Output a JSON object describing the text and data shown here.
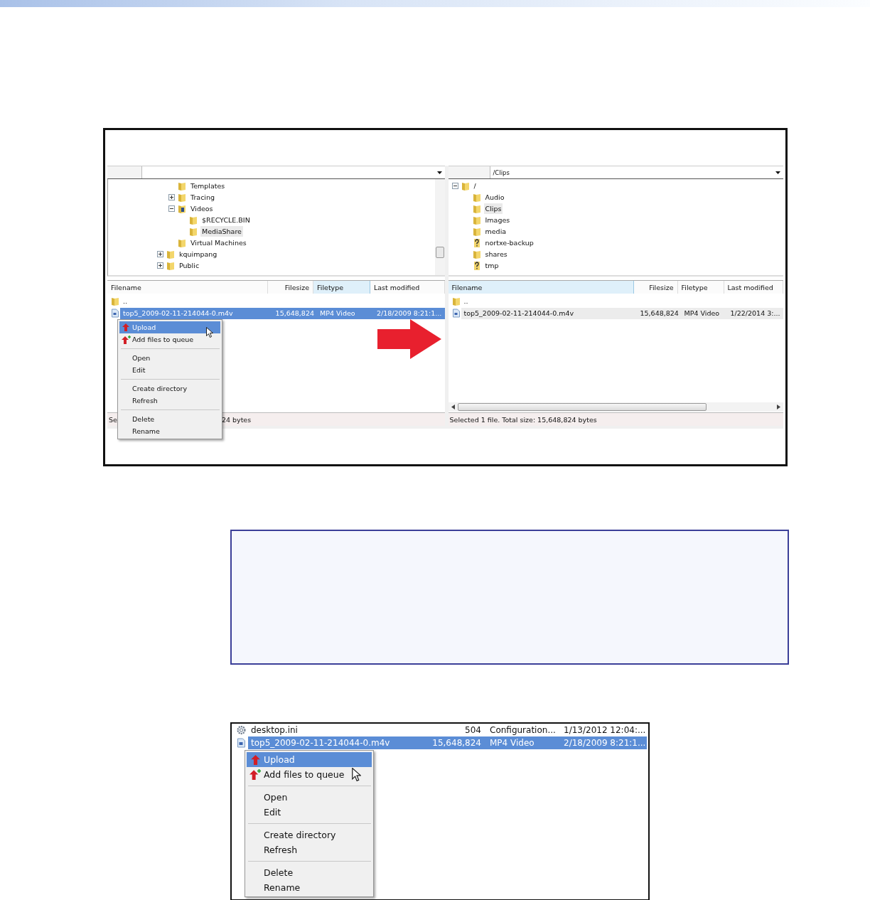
{
  "screenshot_1": {
    "panes": [
      {
        "focused": true,
        "tree": [
          {
            "children": [
              {
                "label": "Templates",
                "kind": "folder",
                "selected": false
              },
              {
                "label": "Tracing",
                "kind": "folder",
                "expanded": false,
                "selected": false
              },
              {
                "label": "Videos",
                "kind": "library",
                "expanded": true,
                "selected": false,
                "children": [
                  {
                    "label": "$RECYCLE.BIN",
                    "kind": "folder",
                    "selected": false
                  },
                  {
                    "label": "MediaShare",
                    "kind": "folder",
                    "selected": true
                  }
                ]
              },
              {
                "label": "Virtual Machines",
                "kind": "folder",
                "selected": false
              }
            ]
          },
          {
            "label": "kquimpang",
            "kind": "folder",
            "expanded": false,
            "selected": false
          },
          {
            "label": "Public",
            "kind": "folder",
            "expanded": false,
            "selected": false
          }
        ],
        "columns": [
          {
            "label": "Filename",
            "sorted": false
          },
          {
            "label": "Filesize",
            "sorted": false
          },
          {
            "label": "Filetype",
            "sorted": true
          },
          {
            "label": "Last modified",
            "sorted": false
          }
        ],
        "rows": [
          {
            "kind": "parent",
            "cells": [
              ".."
            ],
            "selected": false
          },
          {
            "kind": "video",
            "cells": [
              "top5_2009-02-11-214044-0.m4v",
              "15,648,824",
              "MP4 Video",
              "2/18/2009 8:21:1..."
            ],
            "selected": true
          }
        ],
        "status_parts": [
          "Se",
          "24 bytes"
        ]
      },
      {
        "focused": false,
        "path": "/Clips",
        "tree": [
          {
            "label": "/",
            "kind": "folder",
            "expanded": true,
            "selected": false,
            "children": [
              {
                "label": "Audio",
                "kind": "folder",
                "selected": false
              },
              {
                "label": "Clips",
                "kind": "folder",
                "selected": true
              },
              {
                "label": "Images",
                "kind": "folder",
                "selected": false
              },
              {
                "label": "media",
                "kind": "folder",
                "selected": false
              },
              {
                "label": "nortxe-backup",
                "kind": "unknown",
                "selected": false
              },
              {
                "label": "shares",
                "kind": "folder",
                "selected": false
              },
              {
                "label": "tmp",
                "kind": "unknown",
                "selected": false
              }
            ]
          }
        ],
        "columns": [
          {
            "label": "Filename",
            "sorted": true
          },
          {
            "label": "Filesize",
            "sorted": false
          },
          {
            "label": "Filetype",
            "sorted": false
          },
          {
            "label": "Last modified",
            "sorted": false
          }
        ],
        "rows": [
          {
            "kind": "parent",
            "cells": [
              ".."
            ],
            "selected": false
          },
          {
            "kind": "video",
            "cells": [
              "top5_2009-02-11-214044-0.m4v",
              "15,648,824",
              "MP4 Video",
              "1/22/2014 3:..."
            ],
            "selected": true
          }
        ],
        "status_parts": [
          "Selected 1 file. Total size: 15,648,824 bytes"
        ]
      }
    ],
    "context_menu": {
      "groups": [
        [
          {
            "label": "Upload",
            "kind": "upload",
            "selected": true
          },
          {
            "label": "Add files to queue",
            "kind": "queue",
            "selected": false
          }
        ],
        [
          {
            "label": "Open",
            "selected": false
          },
          {
            "label": "Edit",
            "selected": false
          }
        ],
        [
          {
            "label": "Create directory",
            "selected": false
          },
          {
            "label": "Refresh",
            "selected": false
          }
        ],
        [
          {
            "label": "Delete",
            "selected": false
          },
          {
            "label": "Rename",
            "selected": false
          }
        ]
      ]
    }
  },
  "screenshot_2": {
    "rows": [
      {
        "kind": "config",
        "cells": [
          "desktop.ini",
          "504",
          "Configuration...",
          "1/13/2012 12:04:..."
        ],
        "selected": false
      },
      {
        "kind": "video",
        "cells": [
          "top5_2009-02-11-214044-0.m4v",
          "15,648,824",
          "MP4 Video",
          "2/18/2009 8:21:1..."
        ],
        "selected": true
      }
    ],
    "context_menu": {
      "groups": [
        [
          {
            "label": "Upload",
            "kind": "upload",
            "selected": true
          },
          {
            "label": "Add files to queue",
            "kind": "queue",
            "selected": false
          }
        ],
        [
          {
            "label": "Open",
            "selected": false
          },
          {
            "label": "Edit",
            "selected": false
          }
        ],
        [
          {
            "label": "Create directory",
            "selected": false
          },
          {
            "label": "Refresh",
            "selected": false
          }
        ],
        [
          {
            "label": "Delete",
            "selected": false
          },
          {
            "label": "Rename",
            "selected": false
          }
        ]
      ]
    }
  }
}
